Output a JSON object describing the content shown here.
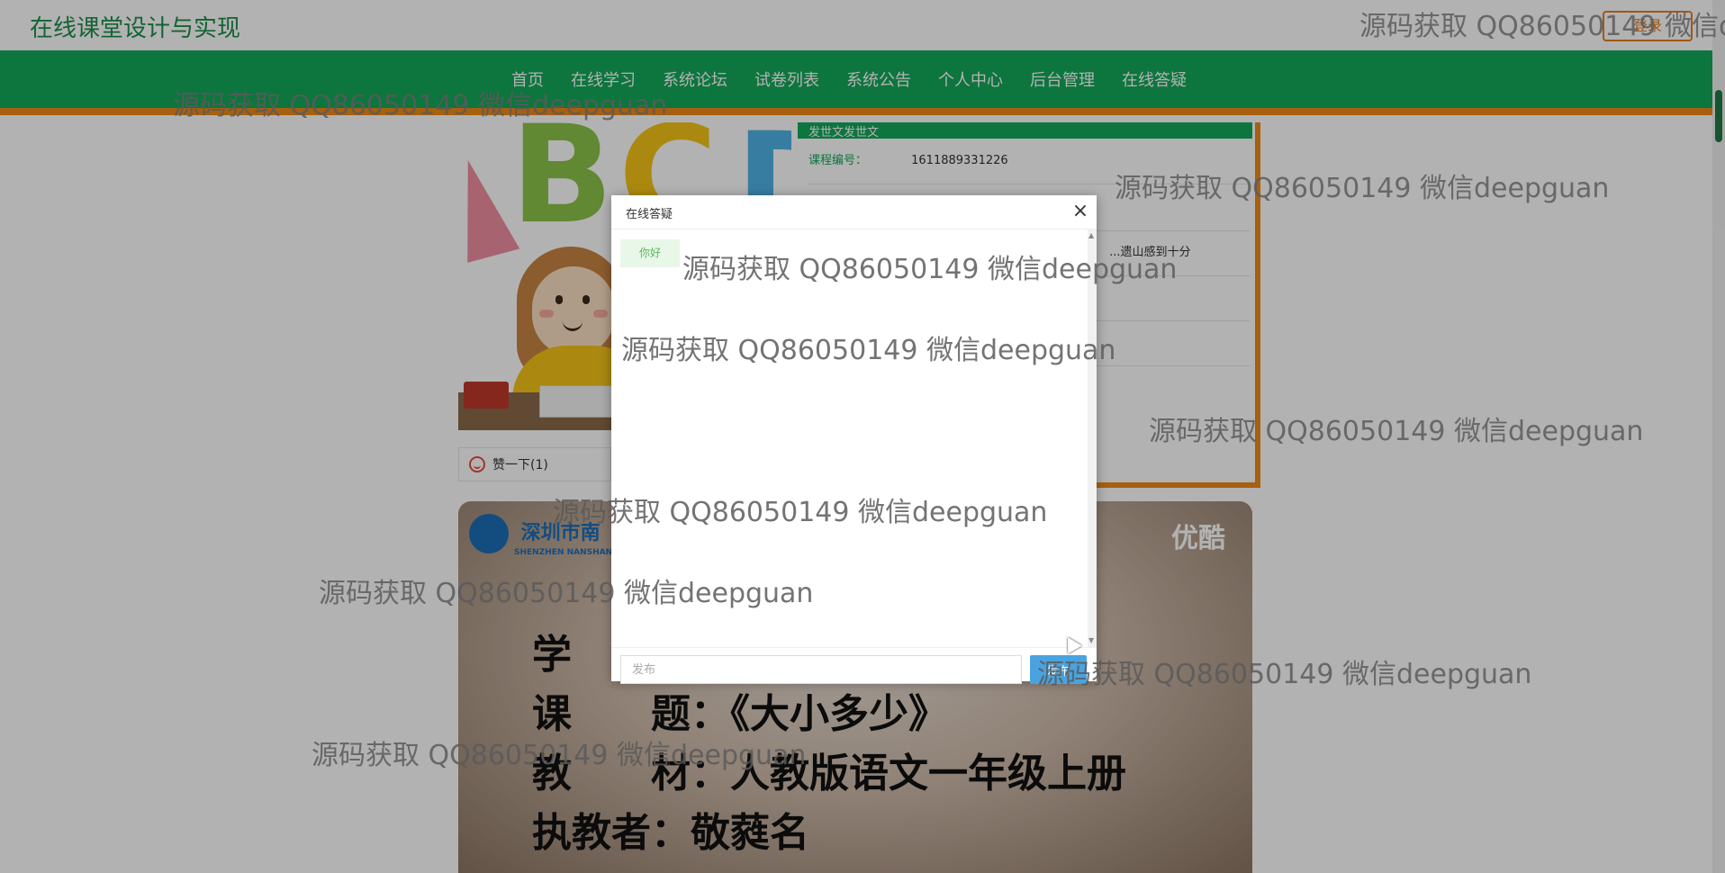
{
  "header": {
    "site_title": "在线课堂设计与实现",
    "login_button": "登录"
  },
  "nav": {
    "items": [
      "首页",
      "在线学习",
      "系统论坛",
      "试卷列表",
      "系统公告",
      "个人中心",
      "后台管理",
      "在线答疑"
    ]
  },
  "hero": {
    "letters": [
      "A",
      "B",
      "C",
      "D"
    ],
    "like_label": "赞一下(1)"
  },
  "info": {
    "header": "发世文发世文",
    "rows": [
      {
        "label": "课程编号：",
        "value": "1611889331226"
      },
      {
        "label": "",
        "value": "...遗山感到十分"
      }
    ]
  },
  "video": {
    "logo_text": "深圳市南",
    "logo_sub": "SHENZHEN NANSHAN",
    "youku": "优酷",
    "lines": [
      "学",
      "课　　题：《大小多少》",
      "教　　材：人教版语文一年级上册",
      "执教者：敬蕤名"
    ]
  },
  "modal": {
    "title": "在线答疑",
    "close": "×",
    "messages": [
      {
        "text": "你好"
      }
    ],
    "input_placeholder": "发布",
    "send_label": "发布"
  },
  "watermark": "源码获取 QQ86050149 微信deepguan",
  "colors": {
    "brand_green": "#13a85a",
    "accent_orange": "#f08a16",
    "title_green": "#1e8f4b",
    "send_blue": "#4aa3df"
  }
}
